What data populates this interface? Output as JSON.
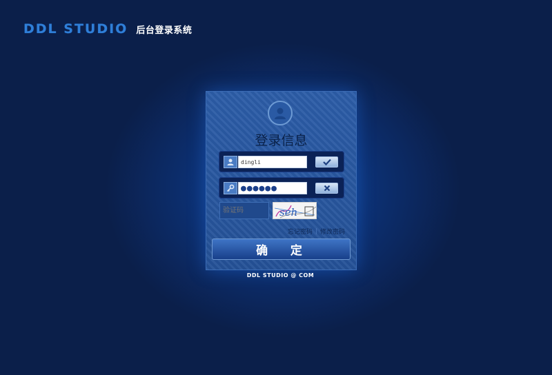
{
  "header": {
    "brand": "DDL STUDIO",
    "subtitle": "后台登录系统"
  },
  "login_panel": {
    "title": "登录信息",
    "username": {
      "value": "dingli",
      "confirm_icon": "check-icon"
    },
    "password": {
      "value": "●●●●●●",
      "clear_icon": "x-icon"
    },
    "captcha": {
      "placeholder": "验证码",
      "image_text": "seh"
    },
    "links": {
      "forgot": "忘记密码",
      "change": "修改密码"
    },
    "submit_label": "确 定"
  },
  "footer": {
    "text": "DDL STUDIO @ COM"
  },
  "colors": {
    "background": "#0b1f4a",
    "brand_blue": "#2f7fd8",
    "panel": "#2c5da8",
    "button": "#2a5cb0"
  }
}
